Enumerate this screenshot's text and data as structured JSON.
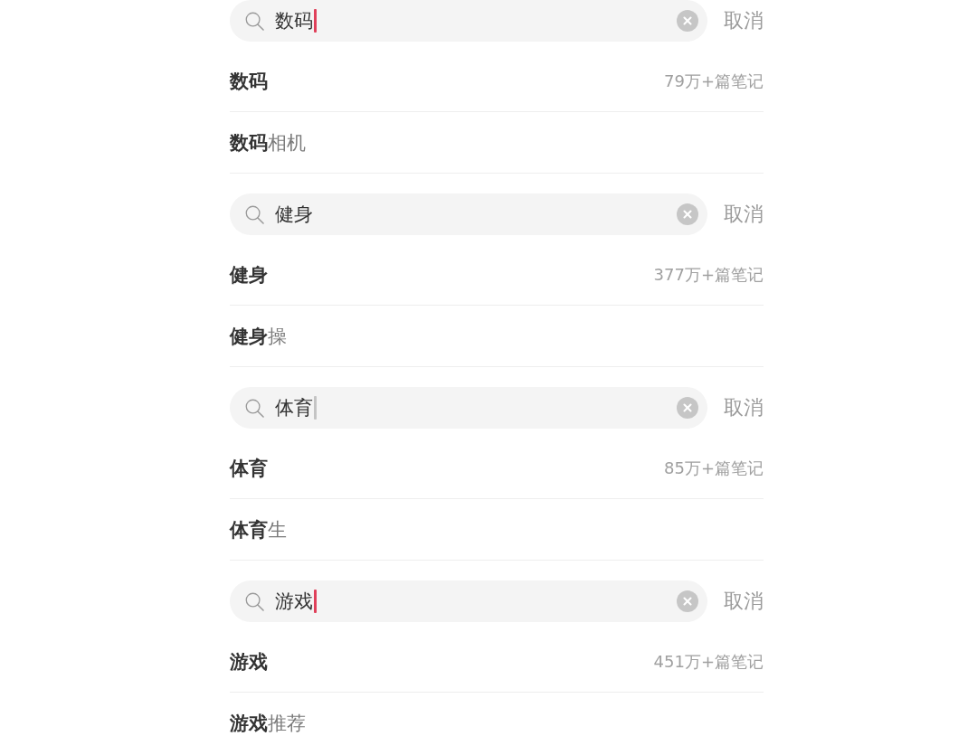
{
  "searches": [
    {
      "query": "数码",
      "focused": true,
      "color": "#e0405a",
      "cancel": "取消",
      "results": [
        {
          "kind": "topic",
          "text": "数码",
          "count": "79万+篇笔记"
        },
        {
          "kind": "completion",
          "text": "**数码**相机"
        }
      ]
    },
    {
      "query": "健身",
      "focused": false,
      "cancel": "取消",
      "results": [
        {
          "kind": "topic",
          "text": "健身",
          "count": "377万+篇笔记"
        },
        {
          "kind": "completion",
          "text": "**健身**操"
        }
      ]
    },
    {
      "query": "体育",
      "focused": true,
      "color": "#c4c4c4",
      "cancel": "取消",
      "results": [
        {
          "kind": "topic",
          "text": "体育",
          "count": "85万+篇笔记"
        },
        {
          "kind": "completion",
          "text": "**体育**生"
        }
      ]
    },
    {
      "query": "游戏",
      "focused": true,
      "color": "#e0405a",
      "cancel": "取消",
      "results": [
        {
          "kind": "topic",
          "text": "游戏",
          "count": "451万+篇笔记"
        },
        {
          "kind": "completion",
          "text": "**游戏**推荐"
        }
      ]
    }
  ]
}
